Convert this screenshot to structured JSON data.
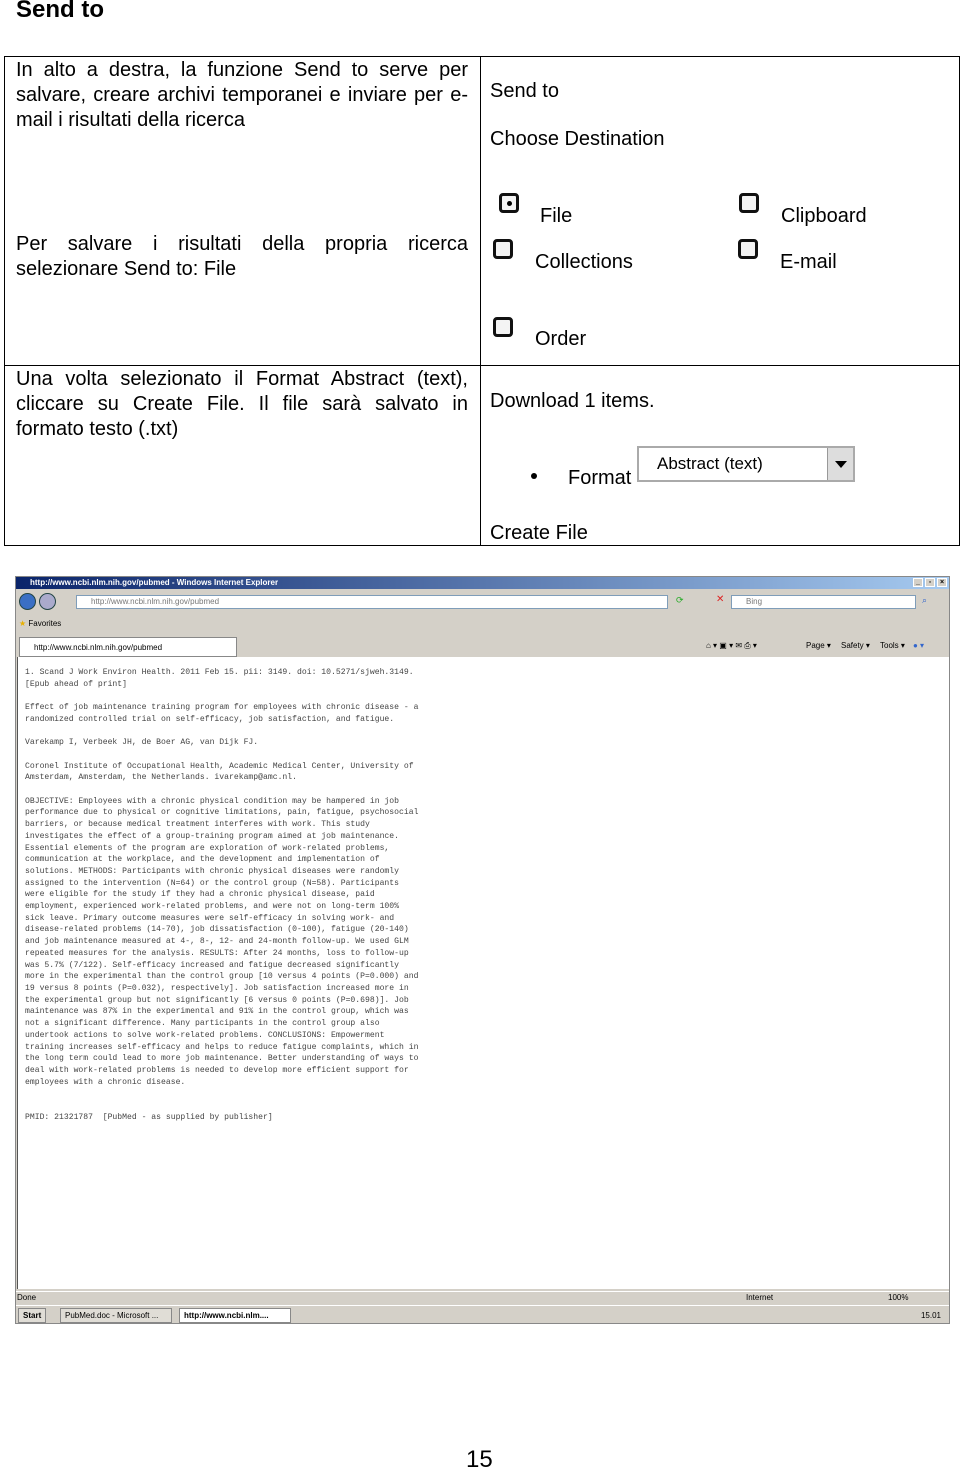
{
  "heading": "Send to",
  "table": {
    "left": {
      "intro": "In alto a destra, la funzione Send to serve per salvare, creare archivi temporanei e inviare per e-mail i risultati della ricerca",
      "save": "Per salvare i risultati della propria ricerca selezionare Send to: File",
      "format": "Una volta selezionato il Format Abstract (text), cliccare su Create File. Il file sarà salvato in formato testo (.txt)"
    },
    "right": {
      "send_to": "Send to",
      "choose": "Choose Destination",
      "options": [
        {
          "label": "File",
          "selected": true
        },
        {
          "label": "Clipboard",
          "selected": false
        },
        {
          "label": "Collections",
          "selected": false
        },
        {
          "label": "E-mail",
          "selected": false
        },
        {
          "label": "Order",
          "selected": false
        }
      ],
      "download": "Download 1 items.",
      "format_label": "Format",
      "format_value": "Abstract (text)",
      "create": "Create File"
    }
  },
  "screenshot": {
    "title": "http://www.ncbi.nlm.nih.gov/pubmed - Windows Internet Explorer",
    "address": "http://www.ncbi.nlm.nih.gov/pubmed",
    "search_placeholder": "Bing",
    "favorites": "Favorites",
    "tab": "http://www.ncbi.nlm.nih.gov/pubmed",
    "commands": [
      "Page ▾",
      "Safety ▾",
      "Tools ▾"
    ],
    "content": "1. Scand J Work Environ Health. 2011 Feb 15. pii: 3149. doi: 10.5271/sjweh.3149.\n[Epub ahead of print]\n\nEffect of job maintenance training program for employees with chronic disease - a\nrandomized controlled trial on self-efficacy, job satisfaction, and fatigue.\n\nVarekamp I, Verbeek JH, de Boer AG, van Dijk FJ.\n\nCoronel Institute of Occupational Health, Academic Medical Center, University of\nAmsterdam, Amsterdam, the Netherlands. ivarekamp@amc.nl.\n\nOBJECTIVE: Employees with a chronic physical condition may be hampered in job\nperformance due to physical or cognitive limitations, pain, fatigue, psychosocial\nbarriers, or because medical treatment interferes with work. This study\ninvestigates the effect of a group-training program aimed at job maintenance.\nEssential elements of the program are exploration of work-related problems,\ncommunication at the workplace, and the development and implementation of\nsolutions. METHODS: Participants with chronic physical diseases were randomly\nassigned to the intervention (N=64) or the control group (N=58). Participants\nwere eligible for the study if they had a chronic physical disease, paid\nemployment, experienced work-related problems, and were not on long-term 100%\nsick leave. Primary outcome measures were self-efficacy in solving work- and\ndisease-related problems (14-70), job dissatisfaction (0-100), fatigue (20-140)\nand job maintenance measured at 4-, 8-, 12- and 24-month follow-up. We used GLM\nrepeated measures for the analysis. RESULTS: After 24 months, loss to follow-up\nwas 5.7% (7/122). Self-efficacy increased and fatigue decreased significantly\nmore in the experimental than the control group [10 versus 4 points (P=0.000) and\n19 versus 8 points (P=0.032), respectively]. Job satisfaction increased more in\nthe experimental group but not significantly [6 versus 0 points (P=0.698)]. Job\nmaintenance was 87% in the experimental and 91% in the control group, which was\nnot a significant difference. Many participants in the control group also\nundertook actions to solve work-related problems. CONCLUSIONS: Empowerment\ntraining increases self-efficacy and helps to reduce fatigue complaints, which in\nthe long term could lead to more job maintenance. Better understanding of ways to\ndeal with work-related problems is needed to develop more efficient support for\nemployees with a chronic disease.\n\n\nPMID: 21321787  [PubMed - as supplied by publisher]",
    "status": "Done",
    "zone": "Internet",
    "zoom": "100%",
    "taskbar": {
      "start": "Start",
      "items": [
        "PubMed.doc - Microsoft ...",
        "http://www.ncbi.nlm...."
      ],
      "clock": "15.01"
    }
  },
  "page_number": "15"
}
